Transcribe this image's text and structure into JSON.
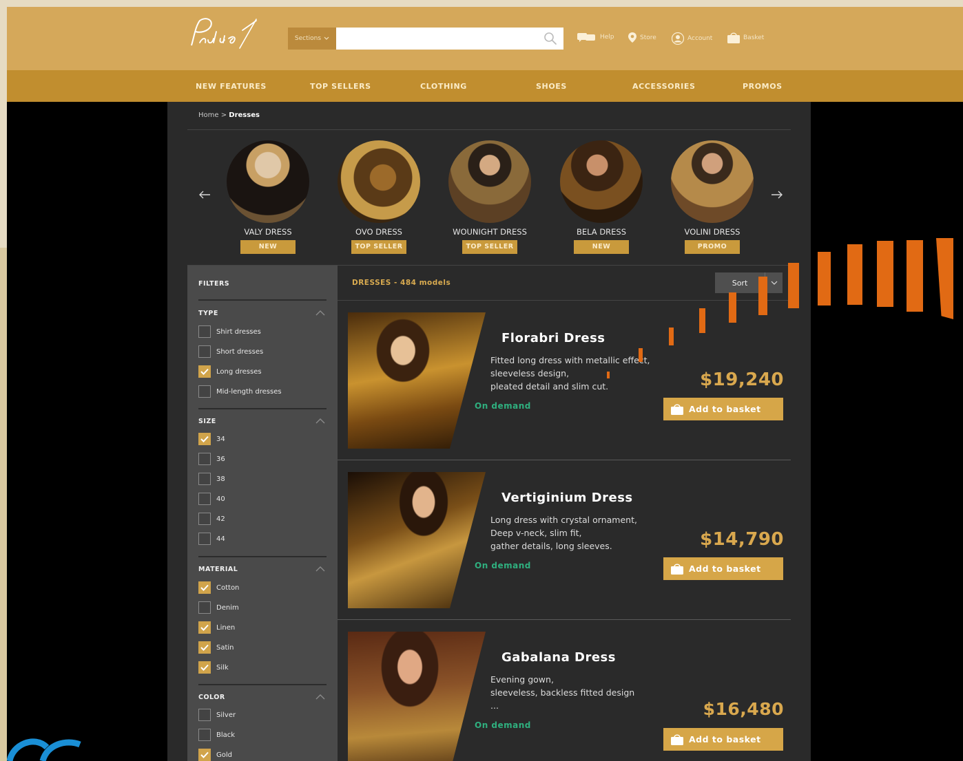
{
  "colors": {
    "header_bg": "#d5a85a",
    "nav_bg": "#c18e2f",
    "accent_gold": "#d6a648",
    "status_green": "#2fb07f",
    "panel_bg": "#2a2a2a",
    "filters_bg": "#4a4a4a",
    "decor_orange": "#e16a14"
  },
  "header": {
    "logo_text": "Paulia",
    "sections_label": "Sections",
    "search_placeholder": "",
    "links": {
      "help": "Help",
      "store": "Store",
      "account": "Account",
      "basket": "Basket"
    }
  },
  "nav": [
    "NEW FEATURES",
    "TOP SELLERS",
    "CLOTHING",
    "SHOES",
    "ACCESSORIES",
    "PROMOS"
  ],
  "breadcrumb": {
    "home": "Home",
    "separator": " > ",
    "current": "Dresses"
  },
  "carousel": [
    {
      "name": "VALY DRESS",
      "badge": "NEW"
    },
    {
      "name": "OVO DRESS",
      "badge": "TOP SELLER"
    },
    {
      "name": "WOUNIGHT DRESS",
      "badge": "TOP SELLER"
    },
    {
      "name": "BELA DRESS",
      "badge": "NEW"
    },
    {
      "name": "VOLINI DRESS",
      "badge": "PROMO"
    }
  ],
  "filters": {
    "title": "FILTERS",
    "type": {
      "title": "TYPE",
      "options": [
        {
          "label": "Shirt dresses",
          "checked": false
        },
        {
          "label": "Short dresses",
          "checked": false
        },
        {
          "label": "Long dresses",
          "checked": true
        },
        {
          "label": "Mid-length dresses",
          "checked": false
        }
      ]
    },
    "size": {
      "title": "SIZE",
      "options": [
        {
          "label": "34",
          "checked": true
        },
        {
          "label": "36",
          "checked": false
        },
        {
          "label": "38",
          "checked": false
        },
        {
          "label": "40",
          "checked": false
        },
        {
          "label": "42",
          "checked": false
        },
        {
          "label": "44",
          "checked": false
        }
      ]
    },
    "material": {
      "title": "MATERIAL",
      "options": [
        {
          "label": "Cotton",
          "checked": true
        },
        {
          "label": "Denim",
          "checked": false
        },
        {
          "label": "Linen",
          "checked": true
        },
        {
          "label": "Satin",
          "checked": true
        },
        {
          "label": "Silk",
          "checked": true
        }
      ]
    },
    "color": {
      "title": "COLOR",
      "options": [
        {
          "label": "Silver",
          "checked": false
        },
        {
          "label": "Black",
          "checked": false
        },
        {
          "label": "Gold",
          "checked": true
        }
      ]
    }
  },
  "results": {
    "heading": "DRESSES - 484 models",
    "sort_label": "Sort"
  },
  "products": [
    {
      "name": "Florabri Dress",
      "desc": [
        "Fitted long dress with metallic effect,",
        "sleeveless design,",
        "pleated detail and slim cut."
      ],
      "status": "On demand",
      "price": "$19,240",
      "button": "Add to basket"
    },
    {
      "name": "Vertiginium Dress",
      "desc": [
        "Long dress with crystal ornament,",
        "Deep v-neck, slim fit,",
        "gather details, long sleeves."
      ],
      "status": "On demand",
      "price": "$14,790",
      "button": "Add to basket"
    },
    {
      "name": "Gabalana Dress",
      "desc": [
        "Evening gown,",
        "sleeveless, backless fitted design",
        "..."
      ],
      "status": "On demand",
      "price": "$16,480",
      "button": "Add to basket"
    }
  ]
}
